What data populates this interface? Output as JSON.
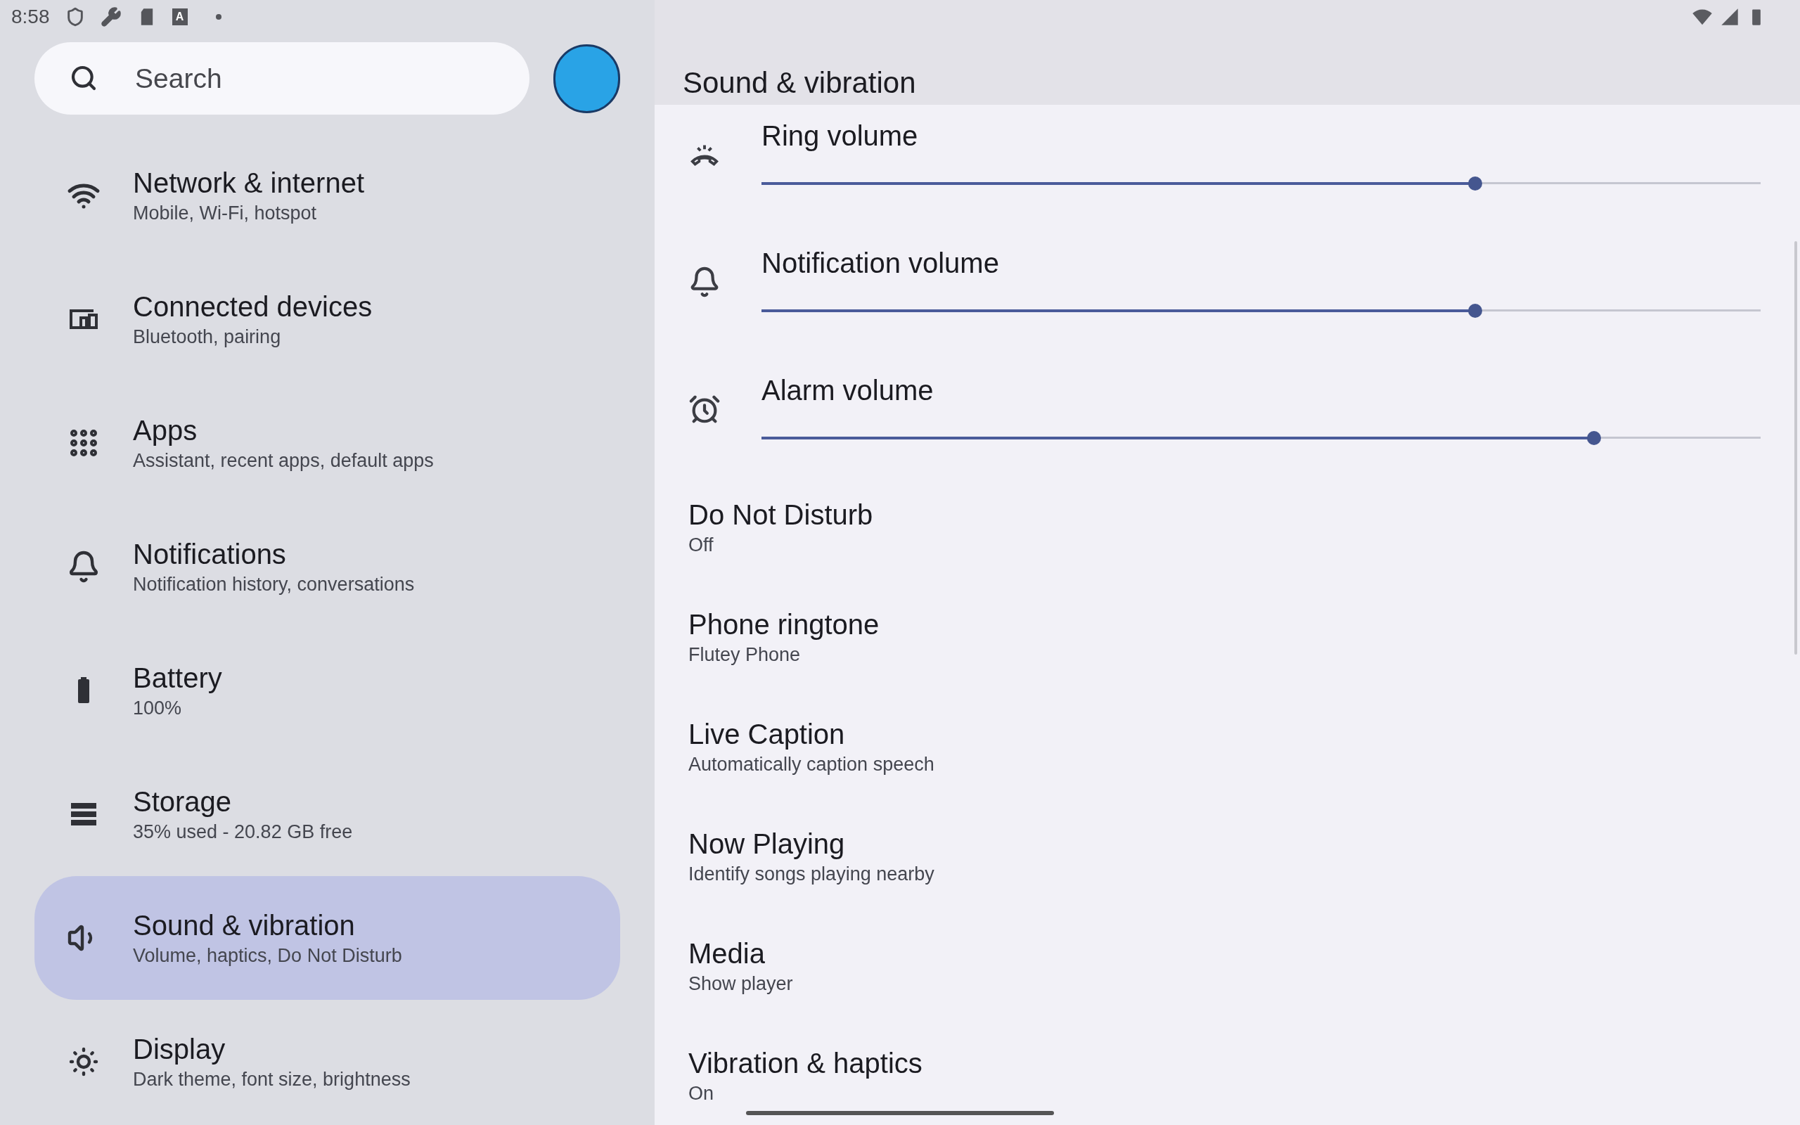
{
  "status_bar": {
    "time": "8:58",
    "keyboard_badge": "A"
  },
  "search": {
    "placeholder": "Search"
  },
  "sidebar": {
    "items": [
      {
        "kind": "network",
        "title": "Network & internet",
        "subtitle": "Mobile, Wi-Fi, hotspot",
        "selected": false
      },
      {
        "kind": "devices",
        "title": "Connected devices",
        "subtitle": "Bluetooth, pairing",
        "selected": false
      },
      {
        "kind": "apps",
        "title": "Apps",
        "subtitle": "Assistant, recent apps, default apps",
        "selected": false
      },
      {
        "kind": "notifications",
        "title": "Notifications",
        "subtitle": "Notification history, conversations",
        "selected": false
      },
      {
        "kind": "battery",
        "title": "Battery",
        "subtitle": "100%",
        "selected": false
      },
      {
        "kind": "storage",
        "title": "Storage",
        "subtitle": "35% used - 20.82 GB free",
        "selected": false
      },
      {
        "kind": "sound",
        "title": "Sound & vibration",
        "subtitle": "Volume, haptics, Do Not Disturb",
        "selected": true
      },
      {
        "kind": "display",
        "title": "Display",
        "subtitle": "Dark theme, font size, brightness",
        "selected": false
      }
    ]
  },
  "page": {
    "title": "Sound & vibration",
    "sliders": [
      {
        "kind": "ring",
        "label": "Ring volume",
        "level": 0.714
      },
      {
        "kind": "notification",
        "label": "Notification volume",
        "level": 0.714
      },
      {
        "kind": "alarm",
        "label": "Alarm volume",
        "level": 0.833
      }
    ],
    "items": [
      {
        "title": "Do Not Disturb",
        "subtitle": "Off"
      },
      {
        "title": "Phone ringtone",
        "subtitle": "Flutey Phone"
      },
      {
        "title": "Live Caption",
        "subtitle": "Automatically caption speech"
      },
      {
        "title": "Now Playing",
        "subtitle": "Identify songs playing nearby"
      },
      {
        "title": "Media",
        "subtitle": "Show player"
      },
      {
        "title": "Vibration & haptics",
        "subtitle": "On"
      }
    ]
  }
}
